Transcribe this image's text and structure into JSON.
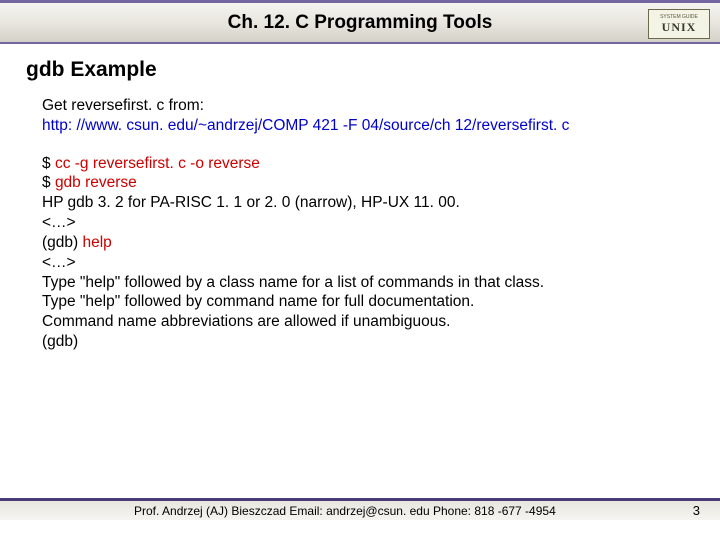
{
  "header": {
    "chapter_title": "Ch. 12. C Programming Tools",
    "logo_small": "SYSTEM GUIDE",
    "logo_big": "UNIX"
  },
  "slide": {
    "heading": "gdb Example",
    "intro_line1": "Get reversefirst. c from:",
    "intro_link": "http: //www. csun. edu/~andrzej/COMP 421 -F 04/source/ch 12/reversefirst. c",
    "line_prompt1": "$ ",
    "cmd1": "cc -g reversefirst. c -o reverse",
    "line_prompt2": "$ ",
    "cmd2": "gdb reverse",
    "line3": "HP gdb 3. 2 for PA-RISC 1. 1 or 2. 0 (narrow), HP-UX 11. 00.",
    "line4": "<…>",
    "line5_pre": "(gdb) ",
    "cmd3": "help",
    "line6": "<…>",
    "line7": "Type \"help\" followed by a class name for a list of commands in that class.",
    "line8": "Type \"help\" followed by command name for full documentation.",
    "line9": "Command name abbreviations are allowed if unambiguous.",
    "line10": "(gdb)"
  },
  "footer": {
    "text": "Prof. Andrzej (AJ) Bieszczad Email: andrzej@csun. edu Phone: 818 -677 -4954",
    "page": "3"
  }
}
